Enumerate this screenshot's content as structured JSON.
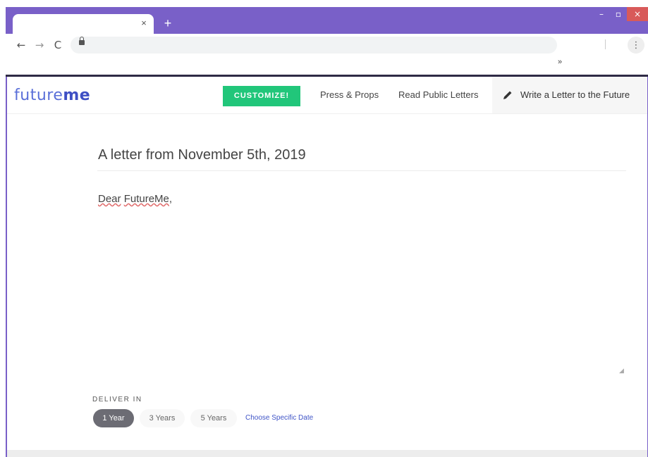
{
  "browser": {
    "tab_close": "×",
    "new_tab": "+",
    "minimize": "–",
    "maximize": "▫",
    "close": "×",
    "back": "←",
    "forward": "→",
    "reload": "C",
    "menu": "⋮",
    "bookmarks_overflow": "»"
  },
  "header": {
    "logo_future": "future",
    "logo_me": "me",
    "customize_label": "CUSTOMIZE!",
    "press_label": "Press & Props",
    "public_letters_label": "Read Public Letters",
    "write_label": "Write a Letter to the Future"
  },
  "letter": {
    "title": "A letter from November 5th, 2019",
    "greeting_word1": "Dear",
    "greeting_word2": "FutureMe",
    "greeting_tail": ","
  },
  "delivery": {
    "label": "DELIVER IN",
    "options": [
      "1 Year",
      "3 Years",
      "5 Years"
    ],
    "selected": "1 Year",
    "specific_date": "Choose Specific Date"
  },
  "colors": {
    "window_frame": "#7960c8",
    "brand": "#3e4fc4",
    "customize": "#21c67a",
    "active_pill": "#6c6c74"
  }
}
